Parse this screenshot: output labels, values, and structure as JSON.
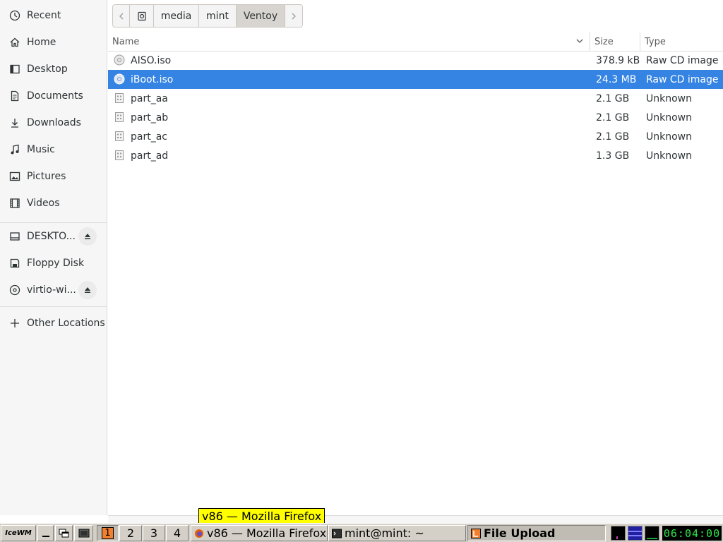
{
  "sidebar": {
    "items": [
      {
        "label": "Recent",
        "icon": "clock-icon"
      },
      {
        "label": "Home",
        "icon": "home-icon"
      },
      {
        "label": "Desktop",
        "icon": "desktop-icon"
      },
      {
        "label": "Documents",
        "icon": "document-icon"
      },
      {
        "label": "Downloads",
        "icon": "download-icon"
      },
      {
        "label": "Music",
        "icon": "music-icon"
      },
      {
        "label": "Pictures",
        "icon": "picture-icon"
      },
      {
        "label": "Videos",
        "icon": "video-icon"
      }
    ],
    "devices": [
      {
        "label": "DESKTO...",
        "icon": "drive-icon",
        "ejectable": true
      },
      {
        "label": "Floppy Disk",
        "icon": "floppy-icon",
        "ejectable": false
      },
      {
        "label": "virtio-wi...",
        "icon": "optical-disc-icon",
        "ejectable": true
      }
    ],
    "other_locations": "Other Locations"
  },
  "pathbar": {
    "segments": [
      "media",
      "mint",
      "Ventoy"
    ],
    "active": "Ventoy"
  },
  "file_list": {
    "columns": {
      "name": "Name",
      "size": "Size",
      "type": "Type"
    },
    "rows": [
      {
        "name": "AISO.iso",
        "size": "378.9 kB",
        "type": "Raw CD image",
        "icon": "disc-image-icon",
        "selected": false
      },
      {
        "name": "iBoot.iso",
        "size": "24.3 MB",
        "type": "Raw CD image",
        "icon": "disc-image-icon",
        "selected": true
      },
      {
        "name": "part_aa",
        "size": "2.1 GB",
        "type": "Unknown",
        "icon": "unknown-file-icon",
        "selected": false
      },
      {
        "name": "part_ab",
        "size": "2.1 GB",
        "type": "Unknown",
        "icon": "unknown-file-icon",
        "selected": false
      },
      {
        "name": "part_ac",
        "size": "2.1 GB",
        "type": "Unknown",
        "icon": "unknown-file-icon",
        "selected": false
      },
      {
        "name": "part_ad",
        "size": "1.3 GB",
        "type": "Unknown",
        "icon": "unknown-file-icon",
        "selected": false
      }
    ]
  },
  "taskbar": {
    "start_label": "IceWM",
    "workspaces": [
      "1",
      "2",
      "3",
      "4"
    ],
    "active_workspace": "1",
    "tasks": [
      {
        "label": "v86 — Mozilla Firefox",
        "icon": "firefox-icon"
      },
      {
        "label": "mint@mint: ~",
        "icon": "terminal-icon"
      },
      {
        "label": "File Upload",
        "icon": "file-upload-icon",
        "active": true
      }
    ],
    "tooltip": "v86 — Mozilla Firefox",
    "clock": "06:04:00"
  },
  "colors": {
    "selection": "#3584e4",
    "sidebar_bg": "#f6f6f6",
    "taskbar_bg": "#d4d0c8",
    "tooltip_bg": "#ffff00",
    "clock_fg": "#2ee84a"
  }
}
